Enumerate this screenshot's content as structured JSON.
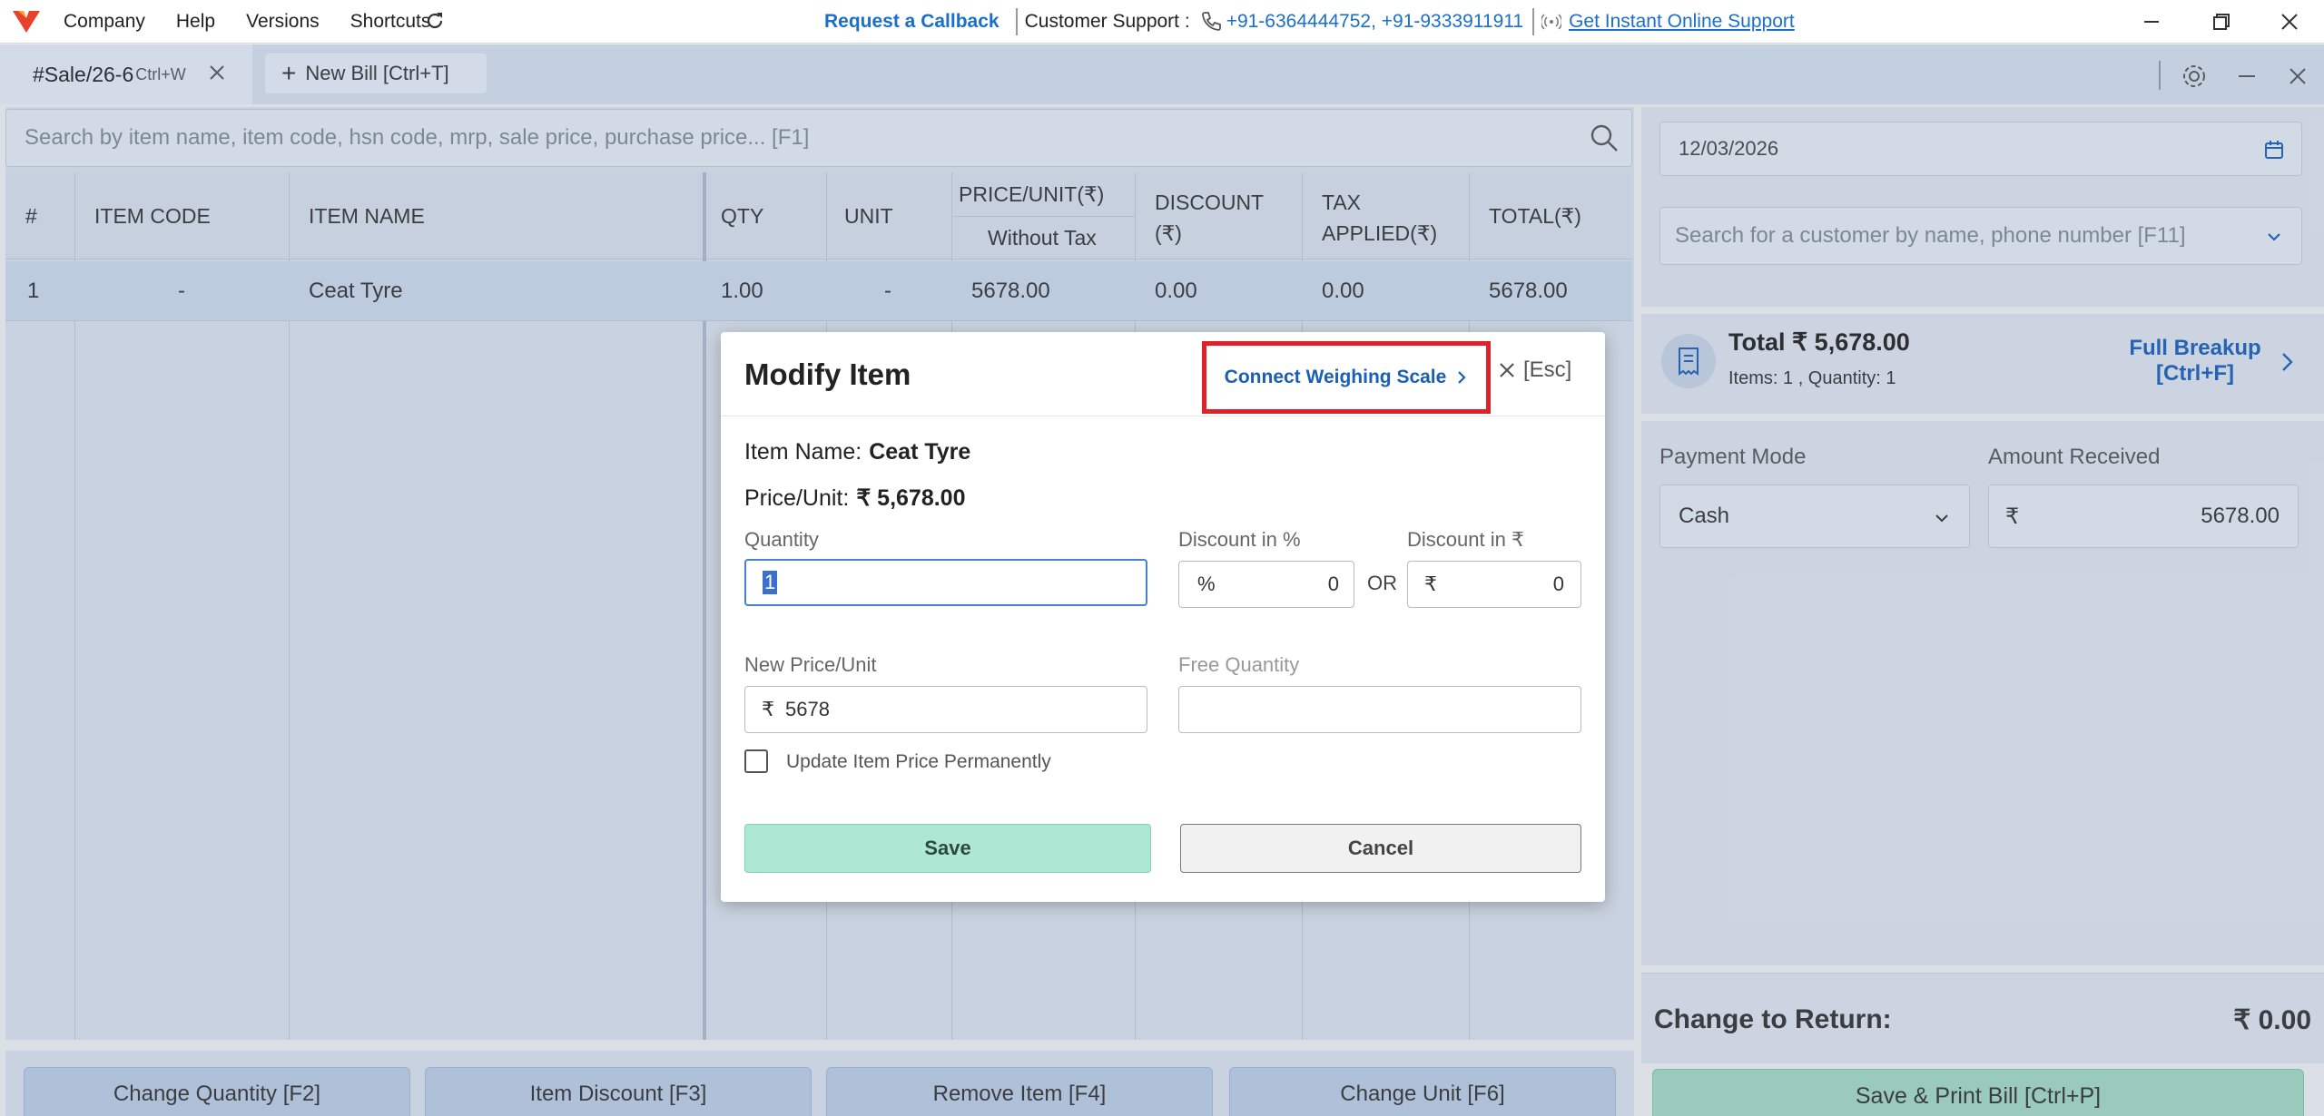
{
  "titlebar": {
    "menu": [
      "Company",
      "Help",
      "Versions",
      "Shortcuts"
    ],
    "request_callback": "Request a Callback",
    "support_label": "Customer Support :",
    "support_phones": "+91-6364444752, +91-9333911911",
    "online_support": "Get Instant Online Support"
  },
  "tabs": {
    "active_tab": "#Sale/26-6",
    "active_tab_shortcut": "Ctrl+W",
    "new_bill": "New Bill [Ctrl+T]"
  },
  "search": {
    "placeholder": "Search by item name, item code, hsn code, mrp, sale price, purchase price... [F1]"
  },
  "table": {
    "headers": {
      "num": "#",
      "item_code": "ITEM CODE",
      "item_name": "ITEM NAME",
      "qty": "QTY",
      "unit": "UNIT",
      "price": "PRICE/UNIT(₹)",
      "price_sub": "Without Tax",
      "discount": "DISCOUNT",
      "discount_sub": "(₹)",
      "tax": "TAX",
      "tax_sub": "APPLIED(₹)",
      "total": "TOTAL(₹)"
    },
    "rows": [
      {
        "num": "1",
        "item_code": "-",
        "item_name": "Ceat Tyre",
        "qty": "1.00",
        "unit": "-",
        "price": "5678.00",
        "discount": "0.00",
        "tax": "0.00",
        "total": "5678.00"
      }
    ]
  },
  "bottom_buttons": [
    "Change Quantity [F2]",
    "Item Discount [F3]",
    "Remove Item [F4]",
    "Change Unit [F6]"
  ],
  "right": {
    "date": "12/03/2026",
    "customer_placeholder": "Search for a customer by name, phone number [F11]",
    "total": "Total ₹ 5,678.00",
    "items_summary": "Items: 1 , Quantity: 1",
    "full_breakup": "Full Breakup",
    "full_breakup_shortcut": "[Ctrl+F]",
    "payment_mode_label": "Payment Mode",
    "payment_mode": "Cash",
    "amount_received_label": "Amount Received",
    "currency": "₹",
    "amount_received": "5678.00",
    "change_label": "Change to Return:",
    "change_value": "₹ 0.00",
    "save_print": "Save & Print Bill [Ctrl+P]"
  },
  "modal": {
    "title": "Modify Item",
    "connect_scale": "Connect Weighing Scale",
    "esc": "[Esc]",
    "item_name_label": "Item Name:",
    "item_name": "Ceat Tyre",
    "price_label": "Price/Unit:",
    "price": "₹ 5,678.00",
    "quantity_label": "Quantity",
    "quantity_value": "1",
    "discount_pct_label": "Discount in %",
    "pct_symbol": "%",
    "discount_pct_value": "0",
    "or": "OR",
    "discount_amt_label": "Discount in ₹",
    "rupee_symbol": "₹",
    "discount_amt_value": "0",
    "new_price_label": "New Price/Unit",
    "new_price_value": "5678",
    "free_qty_label": "Free Quantity",
    "free_qty_value": "",
    "update_price_label": "Update Item Price Permanently",
    "save": "Save",
    "cancel": "Cancel"
  }
}
